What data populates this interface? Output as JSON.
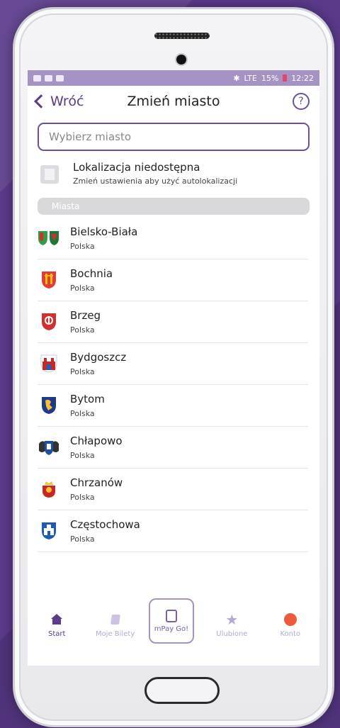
{
  "status_bar": {
    "battery": "15%",
    "time": "12:22",
    "network": "LTE"
  },
  "header": {
    "back_label": "Wróć",
    "title": "Zmień miasto",
    "help": "?"
  },
  "search": {
    "placeholder": "Wybierz miasto",
    "value": ""
  },
  "location": {
    "title": "Lokalizacja niedostępna",
    "subtitle": "Zmień ustawienia aby użyć autolokalizacji"
  },
  "section": {
    "label": "Miasta"
  },
  "cities": [
    {
      "name": "Bielsko-Biała",
      "country": "Polska"
    },
    {
      "name": "Bochnia",
      "country": "Polska"
    },
    {
      "name": "Brzeg",
      "country": "Polska"
    },
    {
      "name": "Bydgoszcz",
      "country": "Polska"
    },
    {
      "name": "Bytom",
      "country": "Polska"
    },
    {
      "name": "Chłapowo",
      "country": "Polska"
    },
    {
      "name": "Chrzanów",
      "country": "Polska"
    },
    {
      "name": "Częstochowa",
      "country": "Polska"
    }
  ],
  "nav": {
    "start": "Start",
    "tickets": "Moje Bilety",
    "mpay": "mPay Go!",
    "favorites": "Ulubione",
    "account": "Konto"
  },
  "colors": {
    "primary": "#5b3a8c",
    "accent_light": "#b6a7d6",
    "status_bar": "#a493c3"
  }
}
